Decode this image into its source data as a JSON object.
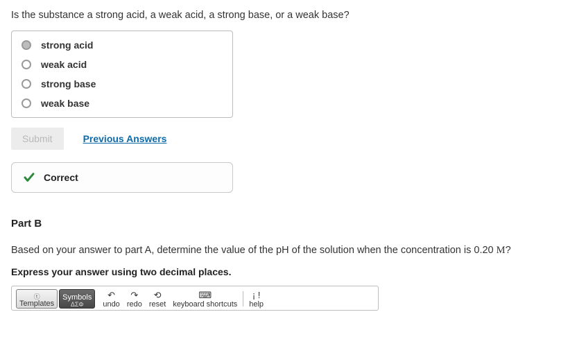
{
  "partA": {
    "question": "Is the substance a strong acid, a weak acid, a strong base, or a weak base?",
    "choices": [
      {
        "label": "strong acid",
        "selected": true
      },
      {
        "label": "weak acid",
        "selected": false
      },
      {
        "label": "strong base",
        "selected": false
      },
      {
        "label": "weak base",
        "selected": false
      }
    ],
    "submit_label": "Submit",
    "prev_link": "Previous Answers",
    "feedback": "Correct"
  },
  "partB": {
    "heading": "Part B",
    "question_prefix": "Based on your answer to part A, determine the value of the pH of the solution when the concentration is 0.20 ",
    "question_unit": "M",
    "question_suffix": "?",
    "instruction": "Express your answer using two decimal places.",
    "toolbar": {
      "templates": "Templates",
      "symbols": "Symbols",
      "undo": "undo",
      "redo": "redo",
      "reset": "reset",
      "keyboard": "keyboard shortcuts",
      "help": "help"
    }
  }
}
